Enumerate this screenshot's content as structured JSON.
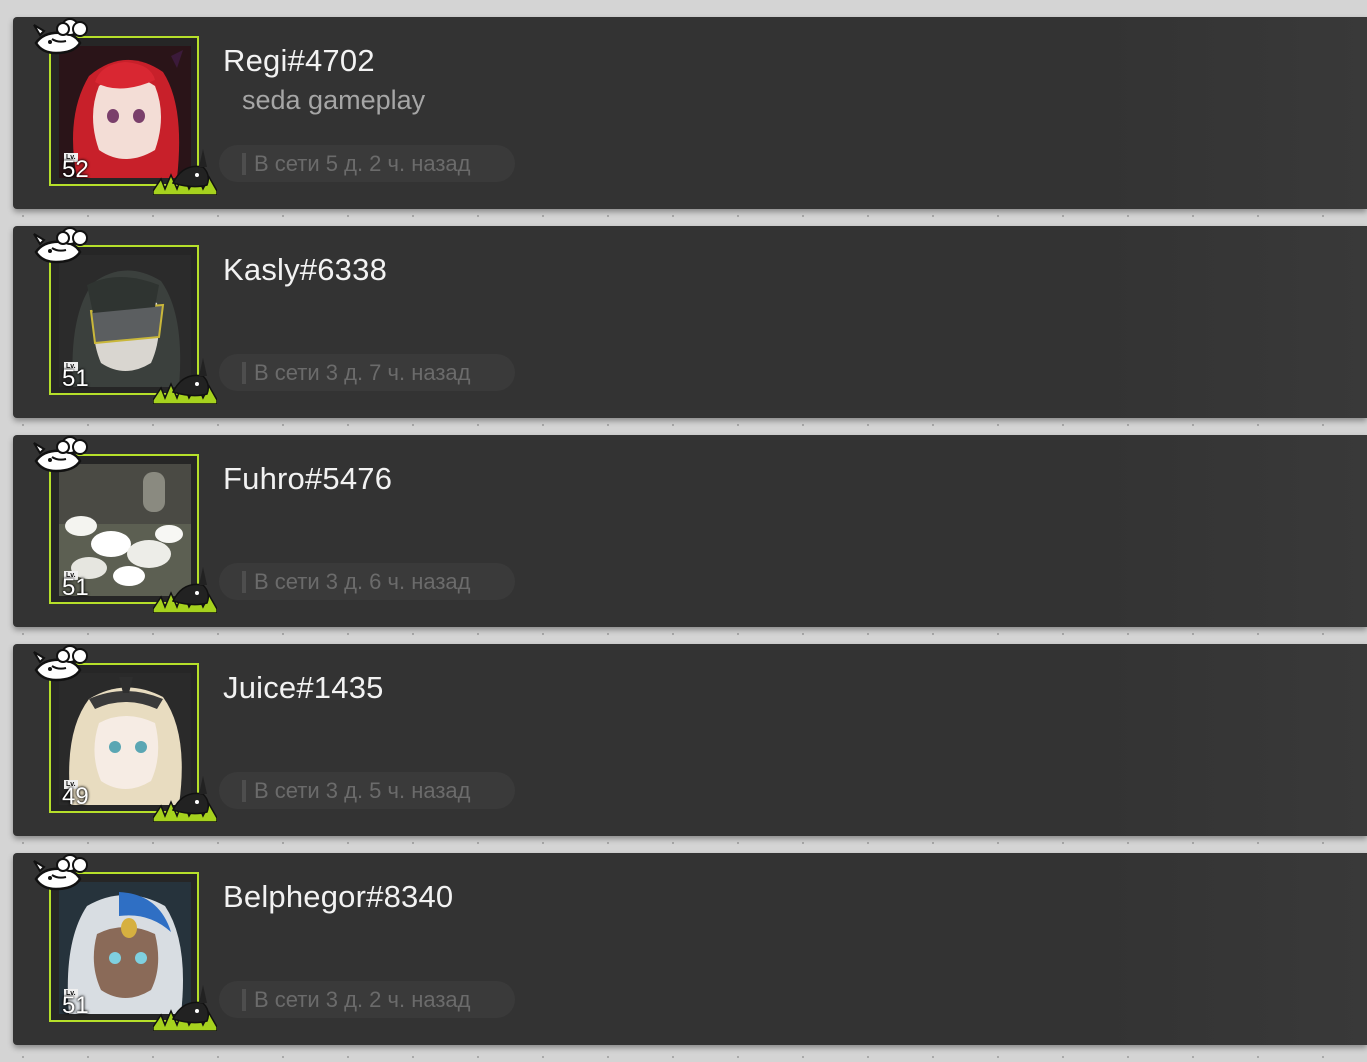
{
  "friends": [
    {
      "username": "Regi#4702",
      "signature": "seda gameplay",
      "level_label": "Lv.",
      "level": "52",
      "status": "В сети 5 д. 2 ч. назад"
    },
    {
      "username": "Kasly#6338",
      "signature": "",
      "level_label": "Lv.",
      "level": "51",
      "status": "В сети 3 д. 7 ч. назад"
    },
    {
      "username": "Fuhro#5476",
      "signature": "",
      "level_label": "Lv.",
      "level": "51",
      "status": "В сети 3 д. 6 ч. назад"
    },
    {
      "username": "Juice#1435",
      "signature": "",
      "level_label": "Lv.",
      "level": "49",
      "status": "В сети 3 д. 5 ч. назад"
    },
    {
      "username": "Belphegor#8340",
      "signature": "",
      "level_label": "Lv.",
      "level": "51",
      "status": "В сети 3 д. 2 ч. назад"
    }
  ],
  "colors": {
    "card_background": "#333333",
    "avatar_border": "#b6e02a",
    "username_text": "#f2f2f2",
    "status_text": "#6b6b6b"
  },
  "icons": {
    "top_emblem": "cloud-creature-icon",
    "corner_decoration": "grass-creature-icon"
  }
}
